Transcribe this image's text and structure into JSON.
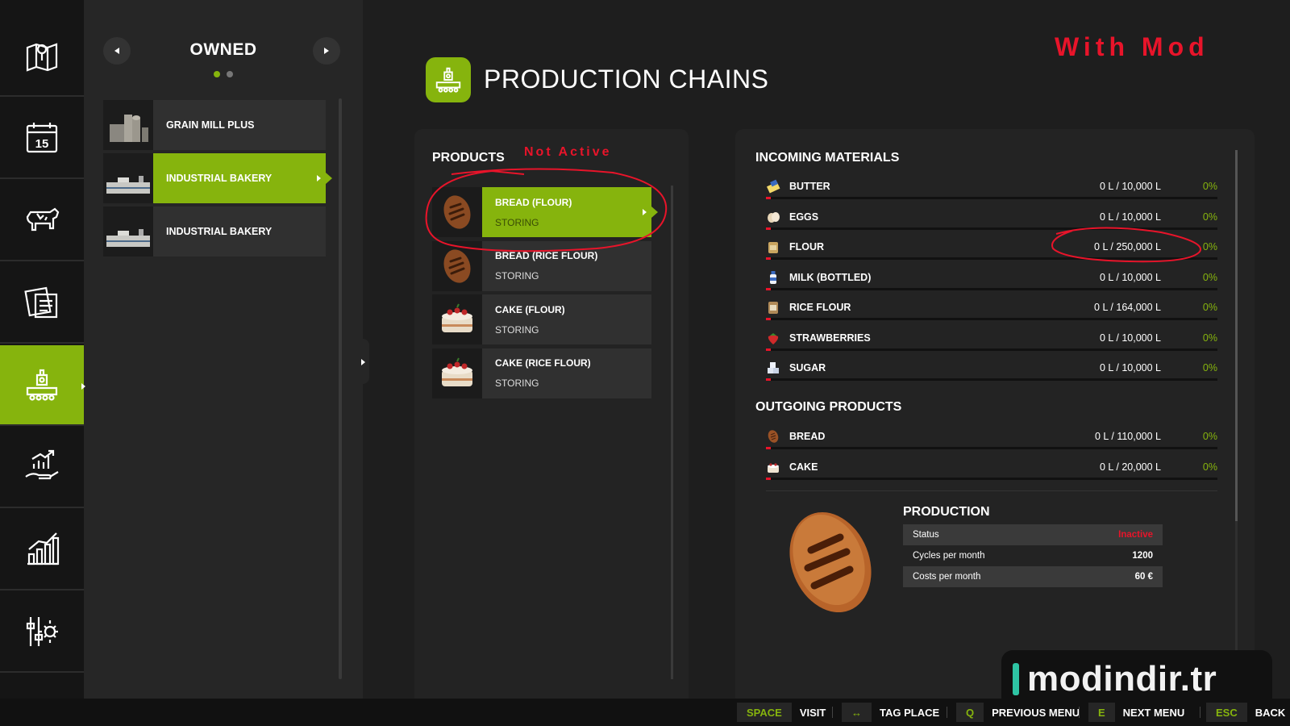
{
  "rail": {
    "items": [
      {
        "icon": "map-icon"
      },
      {
        "icon": "calendar-icon",
        "text": "15"
      },
      {
        "icon": "cow-icon"
      },
      {
        "icon": "contracts-icon"
      },
      {
        "icon": "production-icon",
        "active": true
      },
      {
        "icon": "finance-icon"
      },
      {
        "icon": "statistics-icon"
      },
      {
        "icon": "settings-icon"
      }
    ]
  },
  "owned": {
    "title": "OWNED",
    "items": [
      {
        "label": "GRAIN MILL PLUS"
      },
      {
        "label": "INDUSTRIAL BAKERY",
        "selected": true
      },
      {
        "label": "INDUSTRIAL BAKERY"
      }
    ]
  },
  "header": {
    "title": "PRODUCTION CHAINS"
  },
  "annotations": {
    "with_mod": "With Mod",
    "not_active": "Not Active"
  },
  "products": {
    "title": "PRODUCTS",
    "items": [
      {
        "name": "BREAD (FLOUR)",
        "status": "STORING",
        "icon": "bread-icon",
        "selected": true
      },
      {
        "name": "BREAD (RICE FLOUR)",
        "status": "STORING",
        "icon": "bread-icon"
      },
      {
        "name": "CAKE (FLOUR)",
        "status": "STORING",
        "icon": "cake-icon"
      },
      {
        "name": "CAKE (RICE FLOUR)",
        "status": "STORING",
        "icon": "cake-icon"
      }
    ]
  },
  "incoming": {
    "title": "INCOMING MATERIALS",
    "items": [
      {
        "name": "BUTTER",
        "amount": "0 L / 10,000 L",
        "pct": "0%",
        "icon": "butter-icon"
      },
      {
        "name": "EGGS",
        "amount": "0 L / 10,000 L",
        "pct": "0%",
        "icon": "eggs-icon"
      },
      {
        "name": "FLOUR",
        "amount": "0 L / 250,000 L",
        "pct": "0%",
        "icon": "flour-icon"
      },
      {
        "name": "MILK (BOTTLED)",
        "amount": "0 L / 10,000 L",
        "pct": "0%",
        "icon": "milk-icon"
      },
      {
        "name": "RICE FLOUR",
        "amount": "0 L / 164,000 L",
        "pct": "0%",
        "icon": "rice-flour-icon"
      },
      {
        "name": "STRAWBERRIES",
        "amount": "0 L / 10,000 L",
        "pct": "0%",
        "icon": "strawberry-icon"
      },
      {
        "name": "SUGAR",
        "amount": "0 L / 10,000 L",
        "pct": "0%",
        "icon": "sugar-icon"
      }
    ]
  },
  "outgoing": {
    "title": "OUTGOING PRODUCTS",
    "items": [
      {
        "name": "BREAD",
        "amount": "0 L / 110,000 L",
        "pct": "0%",
        "icon": "bread-icon"
      },
      {
        "name": "CAKE",
        "amount": "0 L / 20,000 L",
        "pct": "0%",
        "icon": "cake-icon"
      }
    ]
  },
  "production": {
    "title": "PRODUCTION",
    "status_label": "Status",
    "status_value": "Inactive",
    "cycles_label": "Cycles per month",
    "cycles_value": "1200",
    "costs_label": "Costs per month",
    "costs_value": "60 €"
  },
  "watermark": "modindir.tr",
  "bottom_hints": [
    {
      "key": "SPACE",
      "label": "VISIT"
    },
    {
      "key": "↔",
      "label": "TAG PLACE"
    },
    {
      "key": "Q",
      "label": "PREVIOUS MENU"
    },
    {
      "key": "E",
      "label": "NEXT MENU"
    },
    {
      "key": "ESC",
      "label": "BACK"
    }
  ],
  "colors": {
    "accent": "#86b40d",
    "annotation_red": "#e8142a",
    "background": "#1e1e1e"
  }
}
